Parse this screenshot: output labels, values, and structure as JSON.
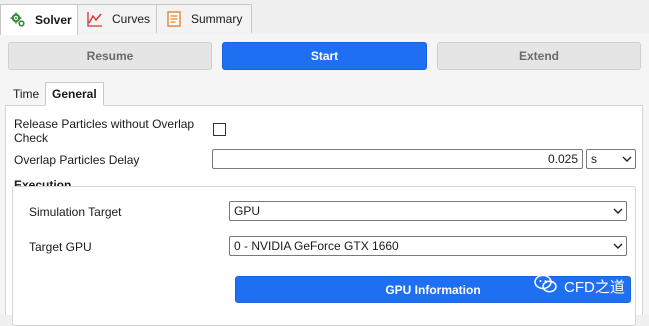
{
  "tabs": {
    "solver": "Solver",
    "curves": "Curves",
    "summary": "Summary"
  },
  "buttons": {
    "resume": "Resume",
    "start": "Start",
    "extend": "Extend"
  },
  "subtabs": {
    "time": "Time",
    "general": "General"
  },
  "general": {
    "release_label": "Release Particles without Overlap Check",
    "release_checked": false,
    "overlap_label": "Overlap Particles Delay",
    "overlap_value": "0.025",
    "overlap_unit": "s"
  },
  "execution": {
    "title": "Execution",
    "target_label": "Simulation Target",
    "target_value": "GPU",
    "gpu_label": "Target GPU",
    "gpu_value": "0 - NVIDIA GeForce GTX 1660",
    "gpu_info_button": "GPU Information"
  },
  "watermark": {
    "text": "CFD之道"
  },
  "icons": {
    "solver": "gears-icon",
    "curves": "line-chart-icon",
    "summary": "document-icon",
    "dropdown": "chevron-down-icon"
  },
  "colors": {
    "accent": "#1e6ff2",
    "curves_icon": "#d8322f",
    "solver_icon": "#2f8a2f",
    "summary_icon": "#e07b20"
  }
}
